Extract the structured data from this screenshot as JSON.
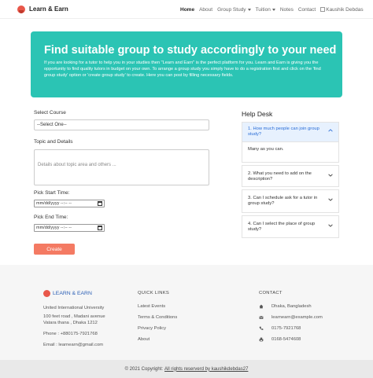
{
  "navbar": {
    "brand": "Learn & Earn",
    "links": [
      "Home",
      "About",
      "Group Study",
      "Tuition",
      "Notes",
      "Contact"
    ],
    "user": "Kaushik Debdas"
  },
  "hero": {
    "title": "Find suitable group to study accordingly to your need",
    "body": "If you are looking for a tutor to help you in your studies then \"Learn and Earn\" is the perfect platform for you. Learn and Earn is giving you the opportunity to find quality tutors in budget on your own. To arrange a group study you simply have to do a registration first and click on the 'find group study' option or 'create group study' to create. Here you can post by filling necessary fields.",
    "accent": "#2bc4b4"
  },
  "form": {
    "course_label": "Select Course",
    "course_value": "--Select One--",
    "topic_label": "Topic and Details",
    "topic_placeholder": "Details about topic area and others ...",
    "start_label": "Pick Start Time:",
    "start_value": "mm/dd/yyyy --:-- --",
    "end_label": "Pick End Time:",
    "end_value": "mm/dd/yyyy --:-- --",
    "create_label": "Create",
    "create_color": "#f47a63"
  },
  "helpdesk": {
    "title": "Help Desk",
    "items": [
      {
        "q": "1. How much people can join group study?",
        "a": "Many as you can.",
        "open": true
      },
      {
        "q": "2. What you need to add on the description?",
        "open": false
      },
      {
        "q": "3. Can I schedule ask for a tutor in group study?",
        "open": false
      },
      {
        "q": "4. Can I select the place of group study?",
        "open": false
      }
    ]
  },
  "footer": {
    "brand": "LEARN & EARN",
    "address1": "United International University",
    "address2": "100 feet road , Madani avenue",
    "address3": "Vatara thana , Dhaka 1212",
    "phone": "Phone : +880175-7921768",
    "email": "Email : learnearn@gmail.com",
    "quick_title": "QUICK LINKS",
    "quick_links": [
      "Latest Events",
      "Terms & Conditions",
      "Privacy Policy",
      "About"
    ],
    "contact_title": "CONTACT",
    "contact": [
      "Dhaka, Bangladesh",
      "learnearn@example.com",
      "0175-7921768",
      "0168-5474608"
    ],
    "copyright_prefix": "© 2021 Copyright:",
    "copyright_link": "All rights reserverd by kaushikdebdas27"
  }
}
